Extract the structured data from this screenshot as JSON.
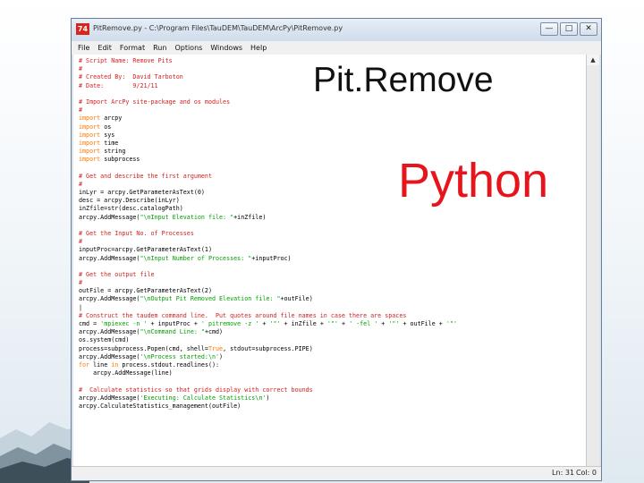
{
  "window": {
    "title": "PitRemove.py - C:\\Program Files\\TauDEM\\TauDEM\\ArcPy\\PitRemove.py",
    "app_icon": "74",
    "controls": {
      "minimize": "—",
      "maximize": "□",
      "close": "✕"
    }
  },
  "menu": [
    "File",
    "Edit",
    "Format",
    "Run",
    "Options",
    "Windows",
    "Help"
  ],
  "code_lines": [
    [
      {
        "t": "# Script Name: Remove Pits",
        "c": "comment"
      }
    ],
    [
      {
        "t": "#",
        "c": "comment"
      }
    ],
    [
      {
        "t": "# Created By:  David Tarboton",
        "c": "comment"
      }
    ],
    [
      {
        "t": "# Date:        9/21/11",
        "c": "comment"
      }
    ],
    [
      {
        "t": "",
        "c": "plain"
      }
    ],
    [
      {
        "t": "# Import ArcPy site-package and os modules",
        "c": "comment"
      }
    ],
    [
      {
        "t": "#",
        "c": "comment"
      }
    ],
    [
      {
        "t": "import",
        "c": "keyword"
      },
      {
        "t": " arcpy",
        "c": "plain"
      }
    ],
    [
      {
        "t": "import",
        "c": "keyword"
      },
      {
        "t": " os",
        "c": "plain"
      }
    ],
    [
      {
        "t": "import",
        "c": "keyword"
      },
      {
        "t": " sys",
        "c": "plain"
      }
    ],
    [
      {
        "t": "import",
        "c": "keyword"
      },
      {
        "t": " time",
        "c": "plain"
      }
    ],
    [
      {
        "t": "import",
        "c": "keyword"
      },
      {
        "t": " string",
        "c": "plain"
      }
    ],
    [
      {
        "t": "import",
        "c": "keyword"
      },
      {
        "t": " subprocess",
        "c": "plain"
      }
    ],
    [
      {
        "t": "",
        "c": "plain"
      }
    ],
    [
      {
        "t": "# Get and describe the first argument",
        "c": "comment"
      }
    ],
    [
      {
        "t": "#",
        "c": "comment"
      }
    ],
    [
      {
        "t": "inLyr = arcpy.GetParameterAsText(0)",
        "c": "plain"
      }
    ],
    [
      {
        "t": "desc = arcpy.Describe(inLyr)",
        "c": "plain"
      }
    ],
    [
      {
        "t": "inZfile=str(desc.catalogPath)",
        "c": "plain"
      }
    ],
    [
      {
        "t": "arcpy.AddMessage(",
        "c": "plain"
      },
      {
        "t": "\"\\nInput Elevation file: \"",
        "c": "string"
      },
      {
        "t": "+inZfile)",
        "c": "plain"
      }
    ],
    [
      {
        "t": "",
        "c": "plain"
      }
    ],
    [
      {
        "t": "# Get the Input No. of Processes",
        "c": "comment"
      }
    ],
    [
      {
        "t": "#",
        "c": "comment"
      }
    ],
    [
      {
        "t": "inputProc=arcpy.GetParameterAsText(1)",
        "c": "plain"
      }
    ],
    [
      {
        "t": "arcpy.AddMessage(",
        "c": "plain"
      },
      {
        "t": "\"\\nInput Number of Processes: \"",
        "c": "string"
      },
      {
        "t": "+inputProc)",
        "c": "plain"
      }
    ],
    [
      {
        "t": "",
        "c": "plain"
      }
    ],
    [
      {
        "t": "# Get the output file",
        "c": "comment"
      }
    ],
    [
      {
        "t": "#",
        "c": "comment"
      }
    ],
    [
      {
        "t": "outFile = arcpy.GetParameterAsText(2)",
        "c": "plain"
      }
    ],
    [
      {
        "t": "arcpy.AddMessage(",
        "c": "plain"
      },
      {
        "t": "\"\\nOutput Pit Removed Elevation file: \"",
        "c": "string"
      },
      {
        "t": "+outFile)",
        "c": "plain"
      }
    ],
    [
      {
        "t": "|",
        "c": "plain"
      }
    ],
    [
      {
        "t": "# Construct the taudem command line.  Put quotes around file names in case there are spaces",
        "c": "comment"
      }
    ],
    [
      {
        "t": "cmd = ",
        "c": "plain"
      },
      {
        "t": "'mpiexec -n '",
        "c": "string"
      },
      {
        "t": " + inputProc + ",
        "c": "plain"
      },
      {
        "t": "' pitremove -z '",
        "c": "string"
      },
      {
        "t": " + ",
        "c": "plain"
      },
      {
        "t": "'\"'",
        "c": "string"
      },
      {
        "t": " + inZfile + ",
        "c": "plain"
      },
      {
        "t": "'\"'",
        "c": "string"
      },
      {
        "t": " + ",
        "c": "plain"
      },
      {
        "t": "' -fel '",
        "c": "string"
      },
      {
        "t": " + ",
        "c": "plain"
      },
      {
        "t": "'\"'",
        "c": "string"
      },
      {
        "t": " + outFile + ",
        "c": "plain"
      },
      {
        "t": "'\"'",
        "c": "string"
      }
    ],
    [
      {
        "t": "arcpy.AddMessage(",
        "c": "plain"
      },
      {
        "t": "\"\\nCommand Line: \"",
        "c": "string"
      },
      {
        "t": "+cmd)",
        "c": "plain"
      }
    ],
    [
      {
        "t": "os.system(cmd)",
        "c": "plain"
      }
    ],
    [
      {
        "t": "process=subprocess.Popen(cmd, shell=",
        "c": "plain"
      },
      {
        "t": "True",
        "c": "keyword"
      },
      {
        "t": ", stdout=subprocess.PIPE)",
        "c": "plain"
      }
    ],
    [
      {
        "t": "arcpy.AddMessage(",
        "c": "plain"
      },
      {
        "t": "'\\nProcess started:\\n'",
        "c": "string"
      },
      {
        "t": ")",
        "c": "plain"
      }
    ],
    [
      {
        "t": "for",
        "c": "keyword"
      },
      {
        "t": " line ",
        "c": "plain"
      },
      {
        "t": "in",
        "c": "keyword"
      },
      {
        "t": " process.stdout.readlines():",
        "c": "plain"
      }
    ],
    [
      {
        "t": "    arcpy.AddMessage(line)",
        "c": "plain"
      }
    ],
    [
      {
        "t": "",
        "c": "plain"
      }
    ],
    [
      {
        "t": "#  Calculate statistics so that grids display with correct bounds",
        "c": "comment"
      }
    ],
    [
      {
        "t": "arcpy.AddMessage(",
        "c": "plain"
      },
      {
        "t": "'Executing: Calculate Statistics\\n'",
        "c": "string"
      },
      {
        "t": ")",
        "c": "plain"
      }
    ],
    [
      {
        "t": "arcpy.CalculateStatistics_management(outFile)",
        "c": "plain"
      }
    ]
  ],
  "status": {
    "line": "Ln: 31",
    "col": "Col: 0"
  },
  "slide": {
    "title": "Pit.Remove",
    "subtitle": "Python"
  },
  "colors": {
    "comment": "#d42020",
    "keyword": "#ff7700",
    "string": "#00a000",
    "subtitle": "#e8141c"
  },
  "icons": {
    "scroll_up": "triangle-up-icon"
  }
}
